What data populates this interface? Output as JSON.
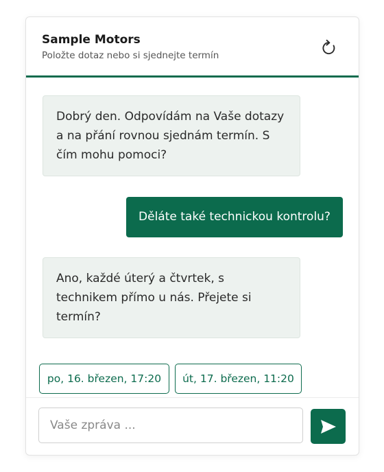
{
  "header": {
    "title": "Sample Motors",
    "subtitle": "Položte dotaz nebo si sjednejte termín",
    "refresh_icon": "refresh-icon"
  },
  "messages": [
    {
      "role": "bot",
      "text": "Dobrý den. Odpovídám na Vaše dotazy a na přání rovnou sjednám termín. S čím mohu pomoci?"
    },
    {
      "role": "user",
      "text": "Děláte také technickou kontrolu?"
    },
    {
      "role": "bot",
      "text": "Ano, každé úterý a čtvrtek, s technikem přímo u nás. Přejete si termín?"
    }
  ],
  "suggestions": [
    "po, 16. březen, 17:20",
    "út, 17. březen, 11:20"
  ],
  "composer": {
    "placeholder": "Vaše zpráva ...",
    "value": "",
    "send_icon": "send-icon"
  },
  "colors": {
    "accent": "#0c6b4d",
    "bot_bubble": "#edf2ef"
  }
}
